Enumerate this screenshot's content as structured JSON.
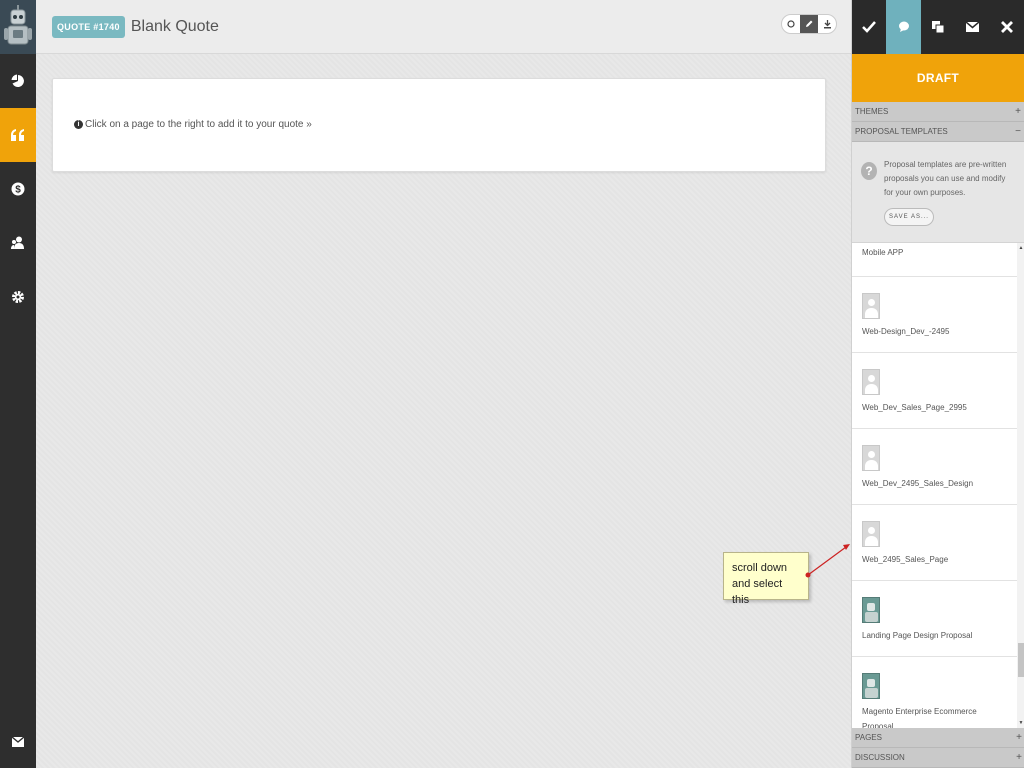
{
  "app": {
    "accent": "#f0a30a",
    "teal": "#7ab9c1"
  },
  "leftnav": {
    "items": [
      {
        "name": "dashboard-icon"
      },
      {
        "name": "quotes-icon"
      },
      {
        "name": "dollar-icon"
      },
      {
        "name": "clients-icon"
      },
      {
        "name": "settings-icon"
      }
    ],
    "bottom_icon": "mail-icon"
  },
  "header": {
    "quote_badge": "QUOTE #1740",
    "title": "Blank Quote",
    "toolbar": [
      "preview-icon",
      "edit-icon",
      "download-icon"
    ]
  },
  "main": {
    "hint": "Click on a page to the right to add it to your quote »"
  },
  "callout": {
    "line1": "scroll down",
    "line2": "and select this"
  },
  "rightpanel": {
    "topbar": [
      "check-icon",
      "comment-icon",
      "copy-icon",
      "email-icon",
      "close-icon"
    ],
    "status": "DRAFT",
    "themes_label": "THEMES",
    "themes_toggle": "+",
    "templates_label": "PROPOSAL TEMPLATES",
    "templates_toggle": "−",
    "templates_desc": "Proposal templates are pre-written proposals you can use and modify for your own purposes.",
    "save_as": "SAVE AS...",
    "templates": [
      {
        "label": "Mobile APP",
        "thumb": "none"
      },
      {
        "label": "Web-Design_Dev_-2495",
        "thumb": "placeholder"
      },
      {
        "label": "Web_Dev_Sales_Page_2995",
        "thumb": "placeholder"
      },
      {
        "label": "Web_Dev_2495_Sales_Design",
        "thumb": "placeholder"
      },
      {
        "label": "Web_2495_Sales_Page",
        "thumb": "placeholder"
      },
      {
        "label": "Landing Page Design Proposal",
        "thumb": "robot"
      },
      {
        "label": "Magento Enterprise Ecommerce Proposal",
        "thumb": "robot"
      }
    ],
    "pages_label": "PAGES",
    "pages_toggle": "+",
    "discussion_label": "DISCUSSION",
    "discussion_toggle": "+"
  }
}
